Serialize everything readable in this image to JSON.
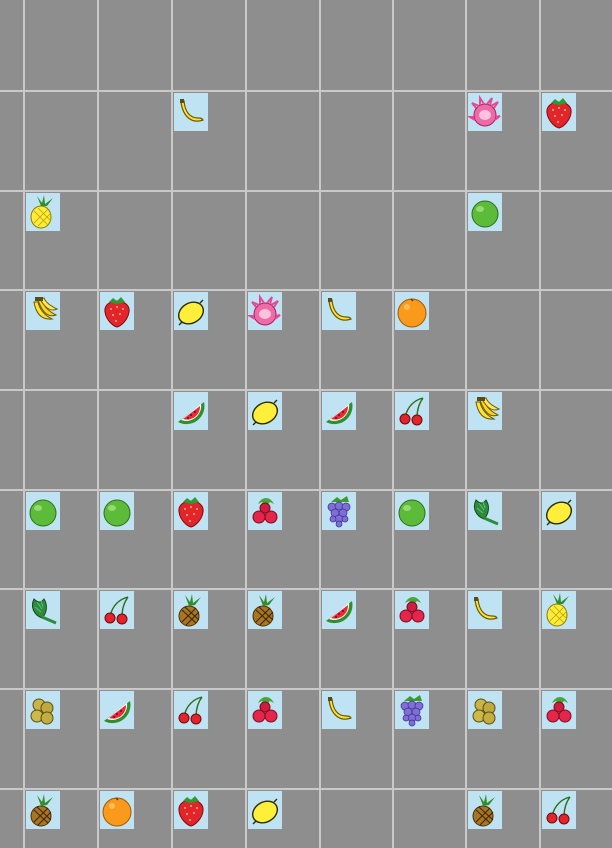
{
  "grid": {
    "cols": 8,
    "rows": 9
  },
  "colors": {
    "board": "#8e8e8e",
    "gridline": "#c9c9c9",
    "tile_bg": "#bfe3f3"
  },
  "tiles": [
    {
      "row": 1,
      "col": 2,
      "fruit": "banana"
    },
    {
      "row": 1,
      "col": 6,
      "fruit": "dragonfruit"
    },
    {
      "row": 1,
      "col": 7,
      "fruit": "strawberry"
    },
    {
      "row": 2,
      "col": 0,
      "fruit": "pineapple-yellow"
    },
    {
      "row": 2,
      "col": 6,
      "fruit": "apple"
    },
    {
      "row": 3,
      "col": 0,
      "fruit": "banana-bunch"
    },
    {
      "row": 3,
      "col": 1,
      "fruit": "strawberry"
    },
    {
      "row": 3,
      "col": 2,
      "fruit": "lemon"
    },
    {
      "row": 3,
      "col": 3,
      "fruit": "dragonfruit"
    },
    {
      "row": 3,
      "col": 4,
      "fruit": "banana"
    },
    {
      "row": 3,
      "col": 5,
      "fruit": "orange"
    },
    {
      "row": 4,
      "col": 2,
      "fruit": "watermelon"
    },
    {
      "row": 4,
      "col": 3,
      "fruit": "lemon"
    },
    {
      "row": 4,
      "col": 4,
      "fruit": "watermelon"
    },
    {
      "row": 4,
      "col": 5,
      "fruit": "cherries"
    },
    {
      "row": 4,
      "col": 6,
      "fruit": "banana-bunch"
    },
    {
      "row": 5,
      "col": 0,
      "fruit": "apple"
    },
    {
      "row": 5,
      "col": 1,
      "fruit": "apple"
    },
    {
      "row": 5,
      "col": 2,
      "fruit": "strawberry"
    },
    {
      "row": 5,
      "col": 3,
      "fruit": "lychee"
    },
    {
      "row": 5,
      "col": 4,
      "fruit": "grapes"
    },
    {
      "row": 5,
      "col": 5,
      "fruit": "apple"
    },
    {
      "row": 5,
      "col": 6,
      "fruit": "artichoke"
    },
    {
      "row": 5,
      "col": 7,
      "fruit": "lemon"
    },
    {
      "row": 6,
      "col": 0,
      "fruit": "artichoke"
    },
    {
      "row": 6,
      "col": 1,
      "fruit": "cherries"
    },
    {
      "row": 6,
      "col": 2,
      "fruit": "pineapple"
    },
    {
      "row": 6,
      "col": 3,
      "fruit": "pineapple"
    },
    {
      "row": 6,
      "col": 4,
      "fruit": "watermelon"
    },
    {
      "row": 6,
      "col": 5,
      "fruit": "lychee"
    },
    {
      "row": 6,
      "col": 6,
      "fruit": "banana"
    },
    {
      "row": 6,
      "col": 7,
      "fruit": "pineapple-yellow"
    },
    {
      "row": 7,
      "col": 0,
      "fruit": "longan"
    },
    {
      "row": 7,
      "col": 1,
      "fruit": "watermelon"
    },
    {
      "row": 7,
      "col": 2,
      "fruit": "cherries"
    },
    {
      "row": 7,
      "col": 3,
      "fruit": "lychee"
    },
    {
      "row": 7,
      "col": 4,
      "fruit": "banana"
    },
    {
      "row": 7,
      "col": 5,
      "fruit": "grapes"
    },
    {
      "row": 7,
      "col": 6,
      "fruit": "longan"
    },
    {
      "row": 7,
      "col": 7,
      "fruit": "lychee"
    },
    {
      "row": 8,
      "col": 0,
      "fruit": "pineapple"
    },
    {
      "row": 8,
      "col": 1,
      "fruit": "orange"
    },
    {
      "row": 8,
      "col": 2,
      "fruit": "strawberry"
    },
    {
      "row": 8,
      "col": 3,
      "fruit": "lemon"
    },
    {
      "row": 8,
      "col": 6,
      "fruit": "pineapple"
    },
    {
      "row": 8,
      "col": 7,
      "fruit": "cherries"
    }
  ]
}
